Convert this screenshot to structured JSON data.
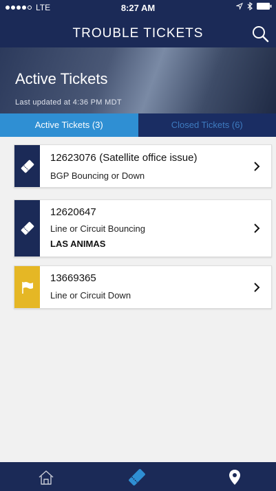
{
  "status": {
    "carrier": "LTE",
    "time": "8:27 AM"
  },
  "header": {
    "title": "TROUBLE TICKETS",
    "search_icon": "search-icon"
  },
  "hero": {
    "title": "Active Tickets",
    "updated": "Last updated at 4:36 PM MDT"
  },
  "tabs": [
    {
      "label": "Active Tickets (3)",
      "selected": true
    },
    {
      "label": "Closed Tickets (6)",
      "selected": false
    }
  ],
  "tickets": [
    {
      "number": "12623076",
      "note": "(Satellite office issue)",
      "description": "BGP Bouncing or Down",
      "location": "",
      "icon": "ticket-icon",
      "color": "#1b2a57"
    },
    {
      "number": "12620647",
      "note": "",
      "description": "Line or Circuit Bouncing",
      "location": "LAS ANIMAS",
      "icon": "ticket-icon",
      "color": "#1b2a57"
    },
    {
      "number": "13669365",
      "note": "",
      "description": "Line or Circuit Down",
      "location": "",
      "icon": "flag-icon",
      "color": "#e5b725"
    }
  ],
  "tabbar": {
    "items": [
      "home-icon",
      "ticket-icon",
      "location-pin-icon"
    ],
    "accent": "#2f8fd3"
  }
}
